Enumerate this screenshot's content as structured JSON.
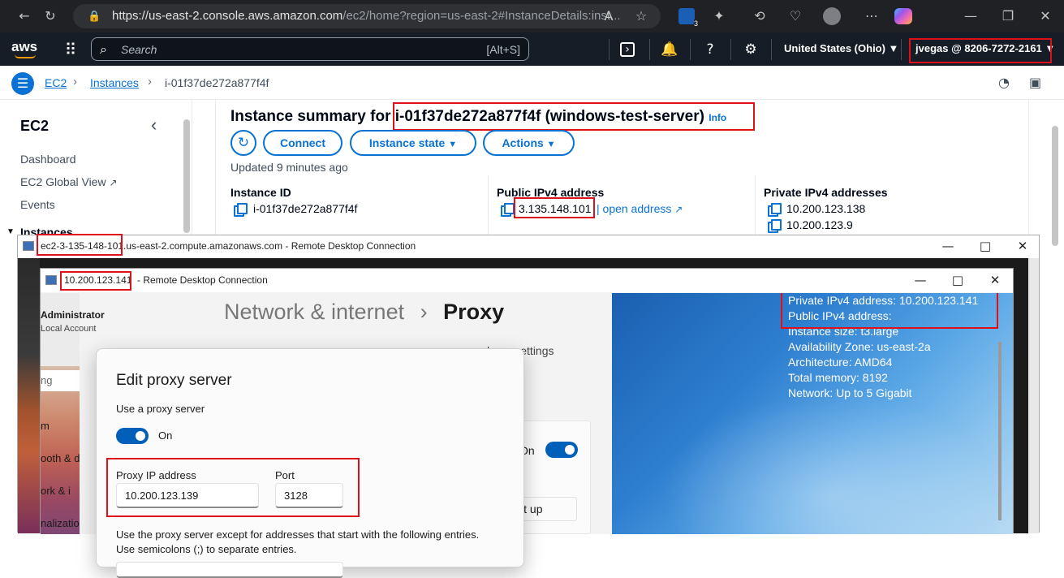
{
  "browser": {
    "url_host": "https://us-east-2.console.aws.amazon.com",
    "url_rest": "/ec2/home?region=us-east-2#InstanceDetails:inst...",
    "ext_badge": "3"
  },
  "aws_nav": {
    "logo": "aws",
    "search_placeholder": "Search",
    "search_shortcut": "[Alt+S]",
    "region": "United States (Ohio) ▼",
    "account": "jvegas @ 8206-7272-2161 ▼"
  },
  "breadcrumb": {
    "items": [
      "EC2",
      "Instances",
      "i-01f37de272a877f4f"
    ]
  },
  "sidebar": {
    "title": "EC2",
    "items": [
      "Dashboard",
      "EC2 Global View",
      "Events",
      "Instances"
    ]
  },
  "summary": {
    "title_prefix": "Instance summary for",
    "title_instance": "i-01f37de272a877f4f (windows-test-server)",
    "info": "Info",
    "buttons": {
      "connect": "Connect",
      "instance_state": "Instance state",
      "actions": "Actions"
    },
    "updated": "Updated 9 minutes ago",
    "instance_id_label": "Instance ID",
    "instance_id": "i-01f37de272a877f4f",
    "public_ip_label": "Public IPv4 address",
    "public_ip": "3.135.148.101",
    "open_address": "| open address",
    "private_ip_label": "Private IPv4 addresses",
    "private_ips": [
      "10.200.123.138",
      "10.200.123.9"
    ]
  },
  "rdp_outer": {
    "title_host": "ec2-3-135-148-101",
    "title_rest": ".us-east-2.compute.amazonaws.com - Remote Desktop Connection"
  },
  "rdp_inner": {
    "title_host": "10.200.123.141",
    "title_rest": "- Remote Desktop Connection",
    "bginfo": [
      "Private IPv4 address: 10.200.123.141",
      "Public IPv4 address:",
      "Instance size: t3.large",
      "Availability Zone: us-east-2a",
      "Architecture: AMD64",
      "Total memory: 8192",
      "Network: Up to 5 Gigabit"
    ]
  },
  "settings": {
    "breadcrumb_left": "Network & internet",
    "breadcrumb_sep": "›",
    "breadcrumb_right": "Proxy",
    "user_name": "Administrator",
    "user_sub": "Local Account",
    "search_partial": "ng",
    "side_partials": [
      "m",
      "ooth & d",
      "ork & i",
      "nalizatio"
    ],
    "these_settings": "hese settings",
    "on_label": "On",
    "setup_button": "Set up"
  },
  "dialog": {
    "title": "Edit proxy server",
    "use_proxy": "Use a proxy server",
    "toggle_state": "On",
    "proxy_ip_label": "Proxy IP address",
    "proxy_ip": "10.200.123.139",
    "port_label": "Port",
    "port": "3128",
    "except_line1": "Use the proxy server except for addresses that start with the following entries.",
    "except_line2": "Use semicolons (;) to separate entries."
  },
  "colors": {
    "aws_nav": "#161d26",
    "link": "#0972d3",
    "highlight": "#e0101a"
  }
}
